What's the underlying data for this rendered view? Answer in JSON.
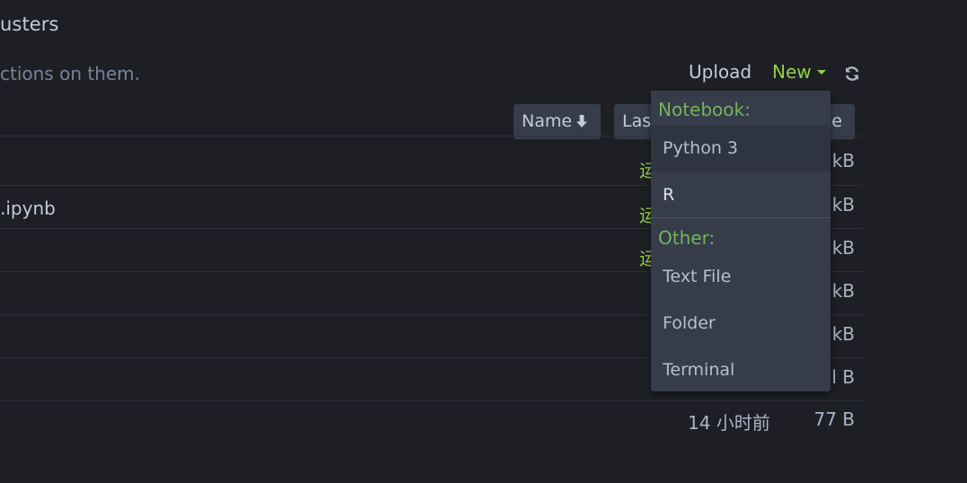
{
  "header": {
    "tab_title": "usters",
    "hint": "ctions on them."
  },
  "toolbar": {
    "upload_label": "Upload",
    "new_label": "New",
    "refresh_icon": "refresh-icon"
  },
  "columns": {
    "name_label": "Name",
    "modified_label": "Las",
    "size_label": "e"
  },
  "rows": [
    {
      "name": "",
      "status": "运",
      "modified": "",
      "size": "kB"
    },
    {
      "name": ".ipynb",
      "status": "运",
      "modified": "",
      "size": "kB"
    },
    {
      "name": "",
      "status": "运",
      "modified": "",
      "size": "kB"
    },
    {
      "name": "",
      "status": "",
      "modified": "",
      "size": "kB"
    },
    {
      "name": "",
      "status": "",
      "modified": "",
      "size": "kB"
    },
    {
      "name": "",
      "status": "",
      "modified": "",
      "size": "l B"
    },
    {
      "name": "",
      "status": "",
      "modified": "14 小时前",
      "size": "77 B"
    }
  ],
  "dropdown": {
    "notebook_header": "Notebook:",
    "notebook_items": [
      "Python 3",
      "R"
    ],
    "other_header": "Other:",
    "other_items": [
      "Text File",
      "Folder",
      "Terminal"
    ]
  },
  "colors": {
    "background": "#1e1f25",
    "accent_green": "#8fd146",
    "menu_bg": "#363c4a"
  }
}
